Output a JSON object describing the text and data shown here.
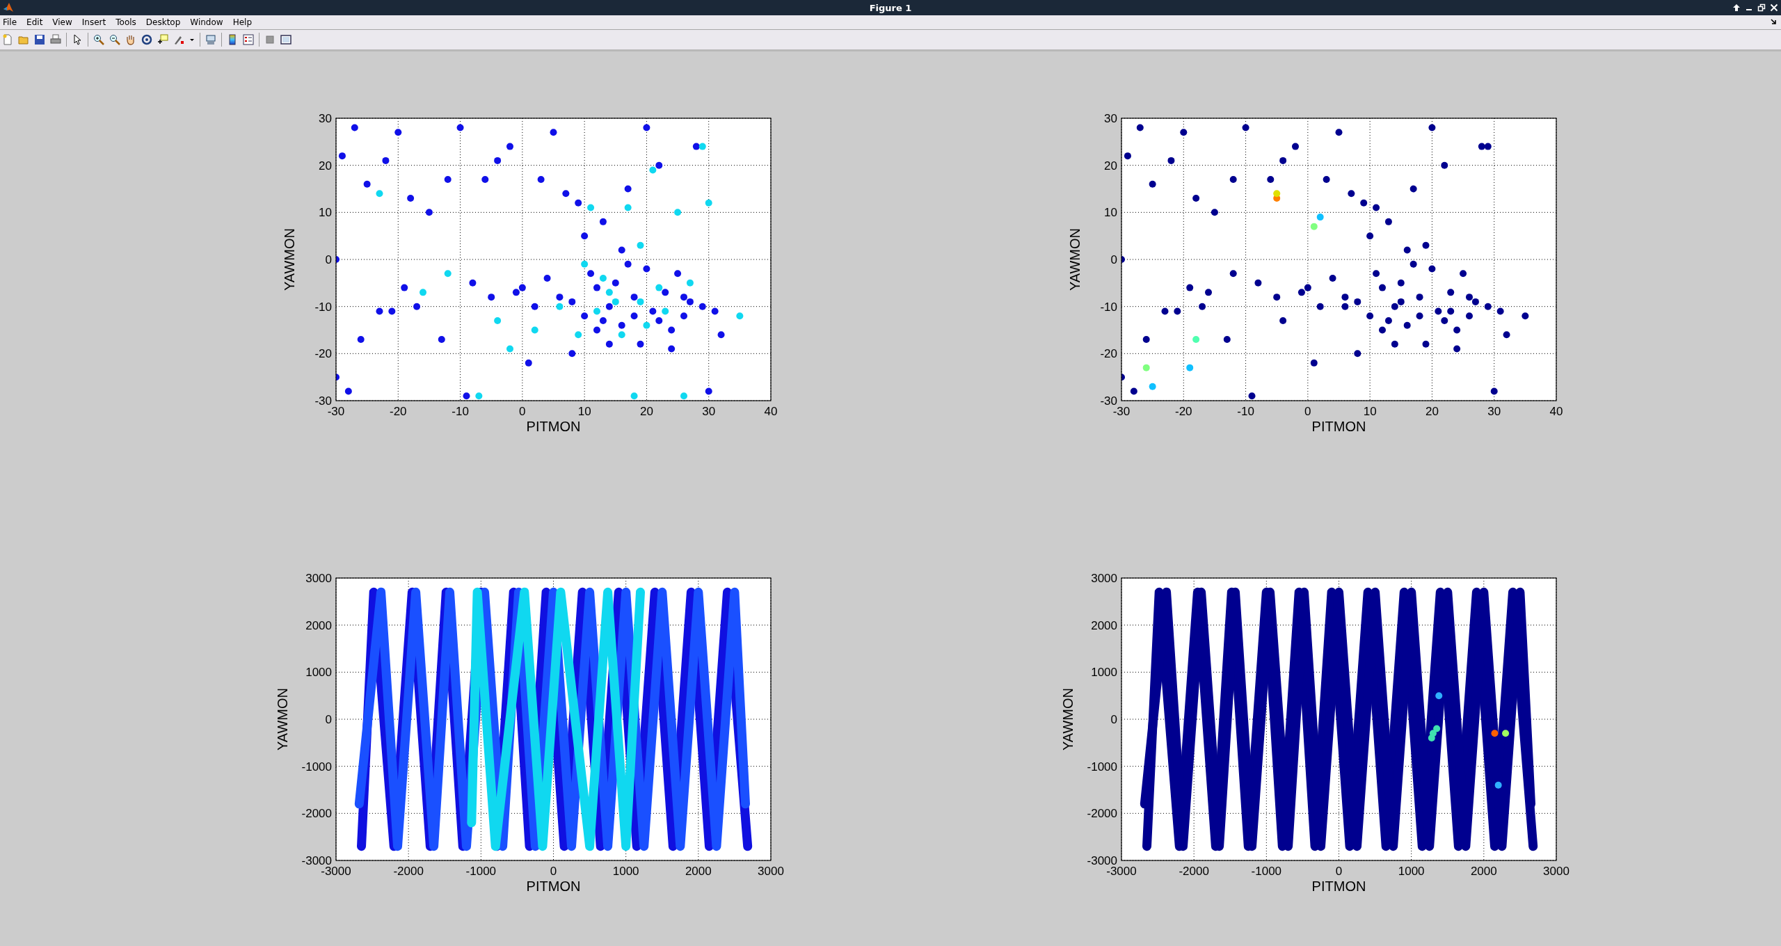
{
  "window": {
    "title": "Figure 1"
  },
  "menu": [
    "File",
    "Edit",
    "View",
    "Insert",
    "Tools",
    "Desktop",
    "Window",
    "Help"
  ],
  "plots": [
    {
      "chart_data": {
        "type": "scatter",
        "xlabel": "PITMON",
        "ylabel": "YAWMON",
        "grid": true,
        "xlim": [
          -30,
          40
        ],
        "ylim": [
          -30,
          30
        ],
        "xticks": [
          -30,
          -20,
          -10,
          0,
          10,
          20,
          30,
          40
        ],
        "yticks": [
          -30,
          -20,
          -10,
          0,
          10,
          20,
          30
        ],
        "series": [
          {
            "color": "#1010e8",
            "x": [
              -28,
              -27,
              -29,
              -25,
              -22,
              -20,
              -18,
              -17,
              -15,
              -12,
              -10,
              -9,
              -8,
              -6,
              -4,
              -2,
              0,
              1,
              3,
              5,
              7,
              8,
              9,
              10,
              11,
              12,
              13,
              14,
              15,
              16,
              17,
              18,
              19,
              20,
              21,
              22,
              23,
              24,
              25,
              26,
              27,
              28,
              29,
              30,
              31,
              32,
              20,
              14,
              12,
              16,
              18,
              22,
              10,
              6,
              4,
              2,
              -1,
              -5,
              -13,
              -19,
              -21,
              -23,
              -26,
              -30,
              -30,
              17,
              24,
              8,
              26,
              13
            ],
            "values": [
              -28,
              28,
              22,
              16,
              21,
              27,
              13,
              -10,
              10,
              17,
              28,
              -29,
              -5,
              17,
              21,
              24,
              -6,
              -22,
              17,
              27,
              14,
              -9,
              12,
              -12,
              -3,
              -15,
              8,
              -10,
              -5,
              -14,
              15,
              -8,
              -18,
              28,
              -11,
              20,
              -7,
              -15,
              -3,
              -12,
              -9,
              24,
              -10,
              -28,
              -11,
              -16,
              -2,
              -18,
              -6,
              2,
              -12,
              -13,
              5,
              -8,
              -4,
              -10,
              -7,
              -8,
              -17,
              -6,
              -11,
              -11,
              -17,
              -25,
              0,
              -1,
              -19,
              -20,
              -8,
              -13
            ]
          },
          {
            "color": "#10d8f0",
            "x": [
              -23,
              -16,
              -12,
              -7,
              -4,
              -2,
              2,
              6,
              9,
              11,
              13,
              15,
              17,
              19,
              20,
              21,
              23,
              25,
              27,
              29,
              30,
              35,
              18,
              26,
              12,
              16,
              22,
              10,
              14,
              19
            ],
            "values": [
              14,
              -7,
              -3,
              -29,
              -13,
              -19,
              -15,
              -10,
              -16,
              11,
              -4,
              -9,
              11,
              3,
              -14,
              19,
              -11,
              10,
              -5,
              24,
              12,
              -12,
              -29,
              -29,
              -11,
              -16,
              -6,
              -1,
              -7,
              -9
            ]
          }
        ]
      }
    },
    {
      "chart_data": {
        "type": "scatter",
        "xlabel": "PITMON",
        "ylabel": "YAWMON",
        "grid": true,
        "xlim": [
          -30,
          40
        ],
        "ylim": [
          -30,
          30
        ],
        "xticks": [
          -30,
          -20,
          -10,
          0,
          10,
          20,
          30,
          40
        ],
        "yticks": [
          -30,
          -20,
          -10,
          0,
          10,
          20,
          30
        ],
        "series": [
          {
            "color": "#00008f",
            "x": [
              -28,
              -27,
              -29,
              -25,
              -22,
              -20,
              -18,
              -17,
              -15,
              -12,
              -10,
              -9,
              -8,
              -6,
              -4,
              -2,
              0,
              1,
              3,
              5,
              7,
              8,
              9,
              10,
              11,
              12,
              13,
              14,
              15,
              16,
              17,
              18,
              19,
              20,
              21,
              22,
              23,
              24,
              25,
              26,
              27,
              28,
              29,
              30,
              31,
              32,
              20,
              14,
              12,
              16,
              18,
              22,
              10,
              6,
              4,
              2,
              -1,
              -5,
              -13,
              -19,
              -21,
              -23,
              -26,
              -30,
              -30,
              17,
              24,
              8,
              26,
              13,
              -16,
              -12,
              -4,
              6,
              11,
              15,
              19,
              23,
              29,
              35
            ],
            "values": [
              -28,
              28,
              22,
              16,
              21,
              27,
              13,
              -10,
              10,
              17,
              28,
              -29,
              -5,
              17,
              21,
              24,
              -6,
              -22,
              17,
              27,
              14,
              -9,
              12,
              -12,
              -3,
              -15,
              8,
              -10,
              -5,
              -14,
              15,
              -8,
              -18,
              28,
              -11,
              20,
              -7,
              -15,
              -3,
              -12,
              -9,
              24,
              -10,
              -28,
              -11,
              -16,
              -2,
              -18,
              -6,
              2,
              -12,
              -13,
              5,
              -8,
              -4,
              -10,
              -7,
              -8,
              -17,
              -6,
              -11,
              -11,
              -17,
              -25,
              0,
              -1,
              -19,
              -20,
              -8,
              -13,
              -7,
              -3,
              -13,
              -10,
              11,
              -9,
              3,
              -11,
              24,
              -12
            ]
          },
          {
            "color": "#ff8000",
            "x": [
              -5
            ],
            "values": [
              13
            ]
          },
          {
            "color": "#e0e000",
            "x": [
              -5
            ],
            "values": [
              14
            ]
          },
          {
            "color": "#80ff80",
            "x": [
              1,
              -26
            ],
            "values": [
              7,
              -23
            ]
          },
          {
            "color": "#10c0ff",
            "x": [
              2,
              -25,
              -19
            ],
            "values": [
              9,
              -27,
              -23
            ]
          },
          {
            "color": "#50ffb0",
            "x": [
              -18
            ],
            "values": [
              -17
            ]
          }
        ]
      }
    },
    {
      "chart_data": {
        "type": "line",
        "xlabel": "PITMON",
        "ylabel": "YAWMON",
        "grid": true,
        "xlim": [
          -3000,
          3000
        ],
        "ylim": [
          -3000,
          3000
        ],
        "xticks": [
          -3000,
          -2000,
          -1000,
          0,
          1000,
          2000,
          3000
        ],
        "yticks": [
          -3000,
          -2000,
          -1000,
          0,
          1000,
          2000,
          3000
        ],
        "series": [
          {
            "color": "#1010e0",
            "x": [
              -2650,
              -2480,
              -2200,
              -1950,
              -1700,
              -1480,
              -1250,
              -1000,
              -780,
              -550,
              -330,
              -100,
              150,
              400,
              650,
              900,
              1150,
              1400,
              1650,
              1900,
              2150,
              2400,
              2680
            ],
            "values": [
              -2700,
              2700,
              -2700,
              2700,
              -2700,
              2700,
              -2700,
              2700,
              -2700,
              2700,
              -2700,
              2700,
              -2700,
              2700,
              -2700,
              2700,
              -2700,
              2700,
              -2700,
              2700,
              -2700,
              2700,
              -2700
            ]
          },
          {
            "color": "#1a50ff",
            "x": [
              -2680,
              -2380,
              -2150,
              -1900,
              -1650,
              -1430,
              -1200,
              -950,
              -700,
              -480,
              -250,
              0,
              250,
              500,
              750,
              1000,
              1250,
              1500,
              1750,
              2000,
              2250,
              2500,
              2650
            ],
            "values": [
              -1800,
              2700,
              -2700,
              2700,
              -2700,
              2700,
              -2700,
              2700,
              -2700,
              2700,
              -2700,
              2700,
              -2700,
              2700,
              -2700,
              2700,
              -2700,
              2700,
              -2700,
              2700,
              -2700,
              2700,
              -1800
            ]
          },
          {
            "color": "#10d8f0",
            "x": [
              -1130,
              -1050,
              -800,
              -400,
              -150,
              100,
              500,
              750,
              1000,
              1200
            ],
            "values": [
              -2200,
              2700,
              -2700,
              2700,
              -2700,
              2700,
              -2700,
              2700,
              -2700,
              2700
            ]
          }
        ]
      }
    },
    {
      "chart_data": {
        "type": "line",
        "xlabel": "PITMON",
        "ylabel": "YAWMON",
        "grid": true,
        "xlim": [
          -3000,
          3000
        ],
        "ylim": [
          -3000,
          3000
        ],
        "xticks": [
          -3000,
          -2000,
          -1000,
          0,
          1000,
          2000,
          3000
        ],
        "yticks": [
          -3000,
          -2000,
          -1000,
          0,
          1000,
          2000,
          3000
        ],
        "series": [
          {
            "color": "#00008f",
            "x": [
              -2650,
              -2480,
              -2200,
              -1950,
              -1700,
              -1480,
              -1250,
              -1000,
              -780,
              -550,
              -330,
              -100,
              150,
              400,
              650,
              900,
              1150,
              1400,
              1650,
              1900,
              2150,
              2400,
              2680
            ],
            "values": [
              -2700,
              2700,
              -2700,
              2700,
              -2700,
              2700,
              -2700,
              2700,
              -2700,
              2700,
              -2700,
              2700,
              -2700,
              2700,
              -2700,
              2700,
              -2700,
              2700,
              -2700,
              2700,
              -2700,
              2700,
              -2700
            ]
          },
          {
            "color": "#00008f",
            "x": [
              -2680,
              -2380,
              -2150,
              -1900,
              -1650,
              -1430,
              -1200,
              -950,
              -700,
              -480,
              -250,
              0,
              250,
              500,
              750,
              1000,
              1250,
              1500,
              1750,
              2000,
              2250,
              2500,
              2650
            ],
            "values": [
              -1800,
              2700,
              -2700,
              2700,
              -2700,
              2700,
              -2700,
              2700,
              -2700,
              2700,
              -2700,
              2700,
              -2700,
              2700,
              -2700,
              2700,
              -2700,
              2700,
              -2700,
              2700,
              -2700,
              2700,
              -1800
            ]
          },
          {
            "type": "scatter",
            "color": "#40e0b0",
            "x": [
              1300,
              1350,
              1280
            ],
            "values": [
              -300,
              -200,
              -400
            ]
          },
          {
            "type": "scatter",
            "color": "#ff6000",
            "x": [
              2150
            ],
            "values": [
              -300
            ]
          },
          {
            "type": "scatter",
            "color": "#30b0ff",
            "x": [
              1380,
              2200
            ],
            "values": [
              500,
              -1400
            ]
          },
          {
            "type": "scatter",
            "color": "#a0ff60",
            "x": [
              2300
            ],
            "values": [
              -300
            ]
          }
        ]
      }
    }
  ]
}
